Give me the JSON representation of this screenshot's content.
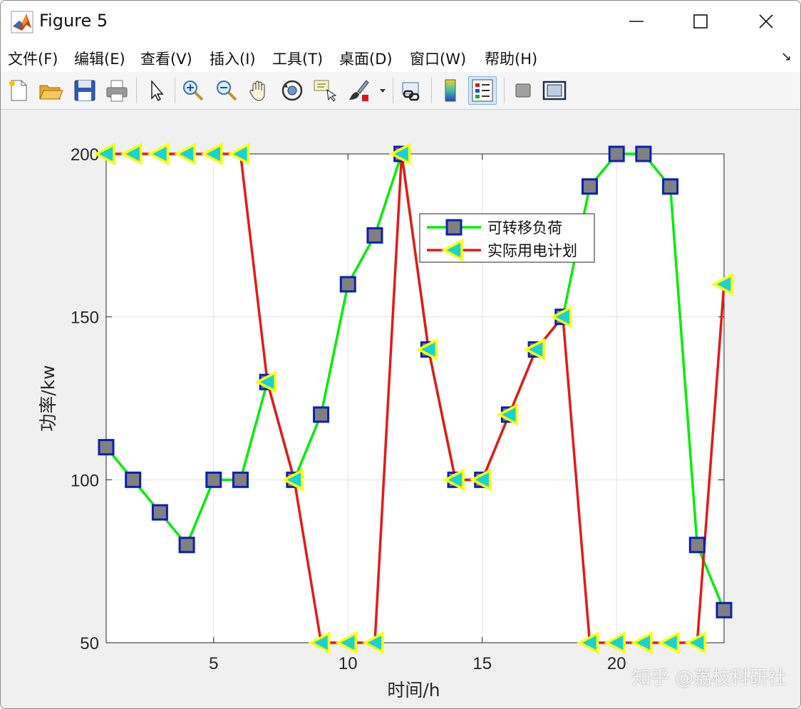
{
  "window": {
    "title": "Figure 5"
  },
  "menu": {
    "items": [
      "文件(F)",
      "编辑(E)",
      "查看(V)",
      "插入(I)",
      "工具(T)",
      "桌面(D)",
      "窗口(W)",
      "帮助(H)"
    ]
  },
  "toolbar": {
    "icons": [
      "new-file-icon",
      "open-folder-icon",
      "save-icon",
      "print-icon",
      "pointer-icon",
      "zoom-in-icon",
      "zoom-out-icon",
      "pan-hand-icon",
      "rotate-3d-icon",
      "data-cursor-icon",
      "brush-icon",
      "link-plot-icon",
      "colorbar-icon",
      "legend-icon",
      "hide-plot-tools-icon",
      "show-plot-tools-icon"
    ]
  },
  "watermark": "知乎 @荔枝科研社",
  "colors": {
    "series1_line": "#00ee00",
    "series1_marker_face": "#808080",
    "series1_marker_edge": "#0b1fb6",
    "series2_line": "#e31a1a",
    "series2_marker_face": "#17d4d4",
    "series2_marker_edge": "#ffff00",
    "grid": "#e3e3e3",
    "axes_bg": "#ffffff"
  },
  "chart_data": {
    "type": "line",
    "title": "",
    "xlabel": "时间/h",
    "ylabel": "功率/kw",
    "xlim": [
      1,
      24
    ],
    "ylim": [
      50,
      200
    ],
    "xticks": [
      5,
      10,
      15,
      20
    ],
    "yticks": [
      50,
      100,
      150,
      200
    ],
    "grid": true,
    "legend_position": "top-center",
    "x": [
      1,
      2,
      3,
      4,
      5,
      6,
      7,
      8,
      9,
      10,
      11,
      12,
      13,
      14,
      15,
      16,
      17,
      18,
      19,
      20,
      21,
      22,
      23,
      24
    ],
    "series": [
      {
        "name": "可转移负荷",
        "marker": "square",
        "values": [
          110,
          100,
          90,
          80,
          100,
          100,
          130,
          100,
          120,
          160,
          175,
          200,
          140,
          100,
          100,
          120,
          140,
          150,
          190,
          200,
          200,
          190,
          80,
          60
        ]
      },
      {
        "name": "实际用电计划",
        "marker": "triangle-left",
        "values": [
          200,
          200,
          200,
          200,
          200,
          200,
          130,
          100,
          50,
          50,
          50,
          200,
          140,
          100,
          100,
          120,
          140,
          150,
          50,
          50,
          50,
          50,
          50,
          160
        ]
      }
    ]
  }
}
